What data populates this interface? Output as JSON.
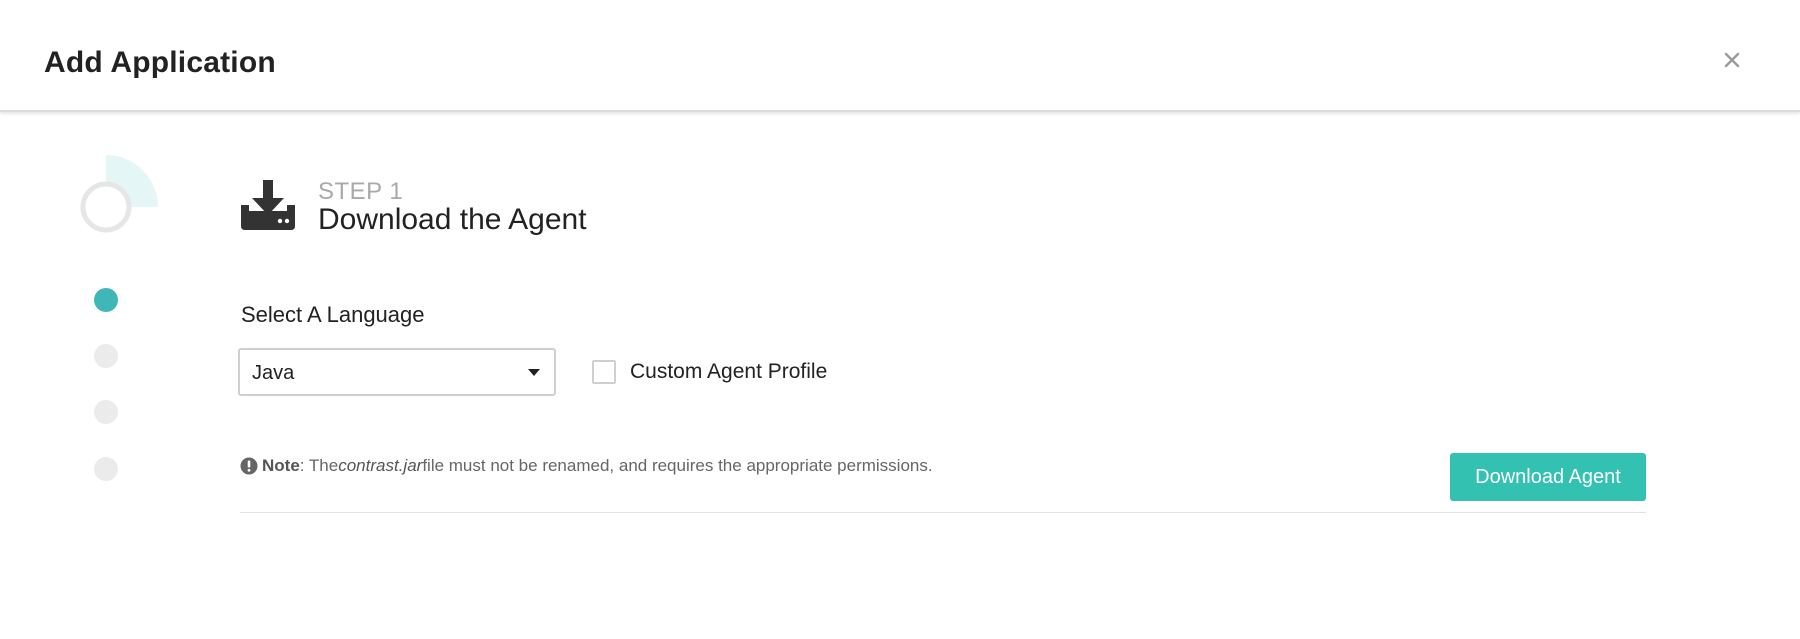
{
  "modal": {
    "title": "Add Application",
    "close_icon": "close-icon"
  },
  "stepper": {
    "current_step": 1,
    "total_steps": 4,
    "progress_fraction": 0.25,
    "active_color": "#3fb7b8",
    "inactive_color": "#ebebeb"
  },
  "step": {
    "label": "STEP 1",
    "title": "Download the Agent",
    "icon": "download-icon"
  },
  "language": {
    "label": "Select A Language",
    "selected": "Java"
  },
  "custom_profile": {
    "label": "Custom Agent Profile",
    "checked": false
  },
  "note": {
    "icon": "exclamation-circle-icon",
    "prefix": "Note",
    "text_before": ": The ",
    "filename": "contrast.jar",
    "text_after": " file must not be renamed, and requires the appropriate permissions."
  },
  "actions": {
    "download_label": "Download Agent",
    "accent_color": "#33c1b1"
  }
}
